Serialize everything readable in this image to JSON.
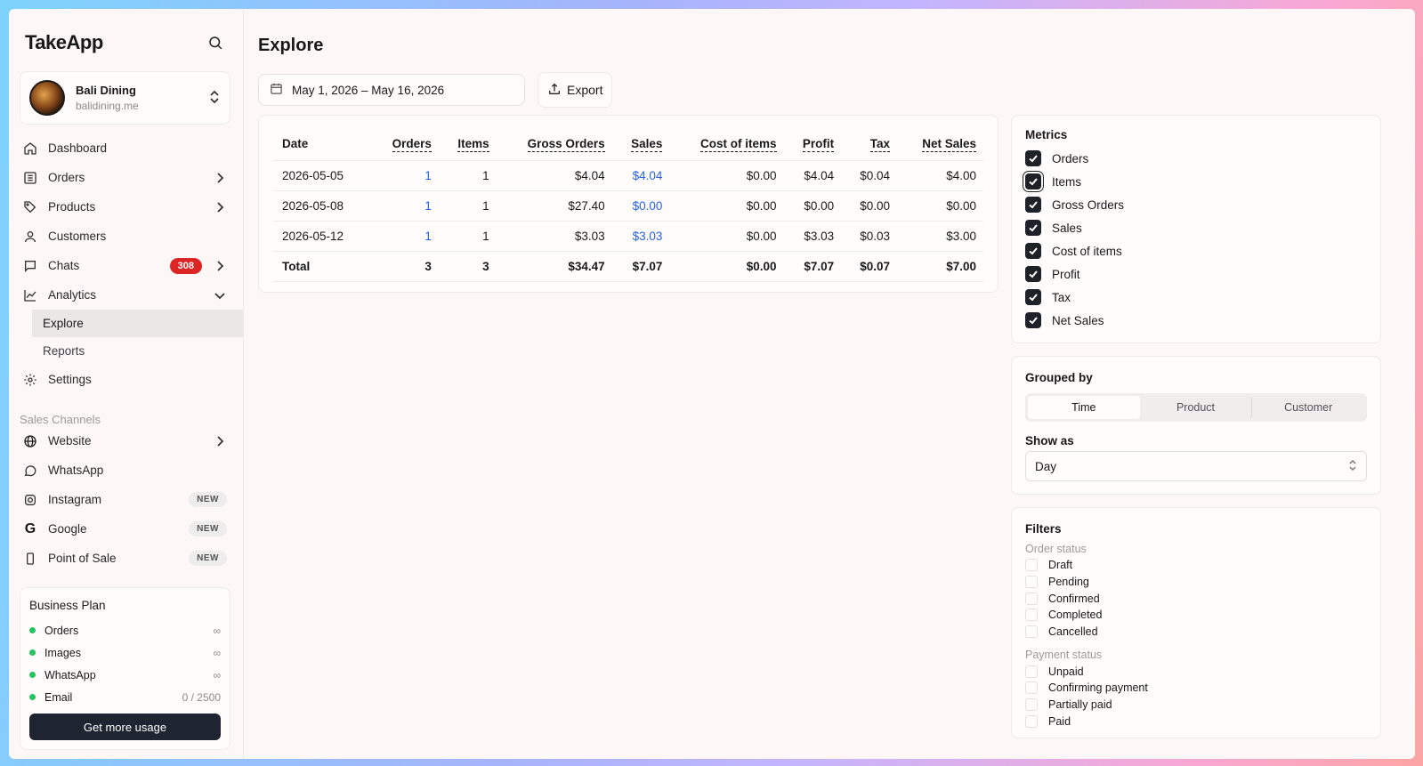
{
  "brand": "TakeApp",
  "store": {
    "name": "Bali Dining",
    "domain": "balidining.me"
  },
  "nav": {
    "dashboard": "Dashboard",
    "orders": "Orders",
    "products": "Products",
    "customers": "Customers",
    "chats": "Chats",
    "chats_badge": "308",
    "analytics": "Analytics",
    "explore": "Explore",
    "reports": "Reports",
    "settings": "Settings"
  },
  "sales_channels": {
    "label": "Sales Channels",
    "website": "Website",
    "whatsapp": "WhatsApp",
    "instagram": "Instagram",
    "google": "Google",
    "pos": "Point of Sale",
    "new_badge": "NEW"
  },
  "plan": {
    "title": "Business Plan",
    "rows": [
      {
        "name": "Orders",
        "value": "∞"
      },
      {
        "name": "Images",
        "value": "∞"
      },
      {
        "name": "WhatsApp",
        "value": "∞"
      },
      {
        "name": "Email",
        "value": "0 / 2500"
      }
    ],
    "button": "Get more usage"
  },
  "main": {
    "title": "Explore",
    "date_range": "May 1, 2026 – May 16, 2026",
    "export_label": "Export"
  },
  "table": {
    "headers": [
      "Date",
      "Orders",
      "Items",
      "Gross Orders",
      "Sales",
      "Cost of items",
      "Profit",
      "Tax",
      "Net Sales"
    ],
    "rows": [
      [
        "2026-05-05",
        "1",
        "1",
        "$4.04",
        "$4.04",
        "$0.00",
        "$4.04",
        "$0.04",
        "$4.00"
      ],
      [
        "2026-05-08",
        "1",
        "1",
        "$27.40",
        "$0.00",
        "$0.00",
        "$0.00",
        "$0.00",
        "$0.00"
      ],
      [
        "2026-05-12",
        "1",
        "1",
        "$3.03",
        "$3.03",
        "$0.00",
        "$3.03",
        "$0.03",
        "$3.00"
      ]
    ],
    "total": [
      "Total",
      "3",
      "3",
      "$34.47",
      "$7.07",
      "$0.00",
      "$7.07",
      "$0.07",
      "$7.00"
    ]
  },
  "metrics": {
    "title": "Metrics",
    "items": [
      "Orders",
      "Items",
      "Gross Orders",
      "Sales",
      "Cost of items",
      "Profit",
      "Tax",
      "Net Sales"
    ]
  },
  "grouping": {
    "title": "Grouped by",
    "options": [
      "Time",
      "Product",
      "Customer"
    ],
    "selected": "Time",
    "show_as_label": "Show as",
    "show_as_value": "Day"
  },
  "filters": {
    "title": "Filters",
    "order_status_label": "Order status",
    "order_status": [
      "Draft",
      "Pending",
      "Confirmed",
      "Completed",
      "Cancelled"
    ],
    "payment_status_label": "Payment status",
    "payment_status": [
      "Unpaid",
      "Confirming payment",
      "Partially paid",
      "Paid"
    ]
  },
  "colors": {
    "accent_dark": "#1f2128",
    "link": "#2563eb",
    "badge_red": "#dc2626",
    "status_green": "#22c55e"
  }
}
